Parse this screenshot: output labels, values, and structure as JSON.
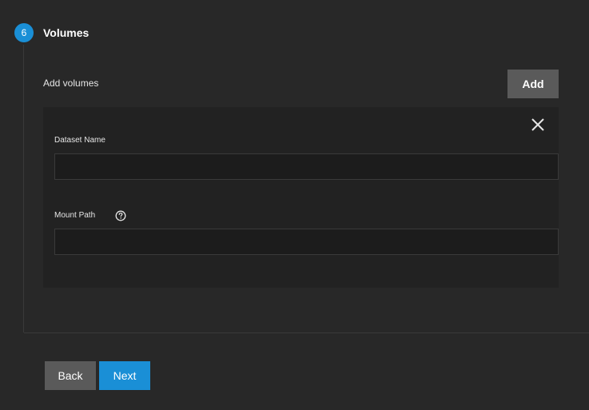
{
  "step": {
    "number": "6",
    "title": "Volumes"
  },
  "volumes": {
    "section_label": "Add volumes",
    "add_label": "Add",
    "dataset_name_label": "Dataset Name",
    "dataset_name_value": "",
    "mount_path_label": "Mount Path",
    "mount_path_value": ""
  },
  "icons": {
    "close": "close-icon",
    "help": "help-circle-icon"
  },
  "footer": {
    "back_label": "Back",
    "next_label": "Next"
  },
  "colors": {
    "accent": "#1a8fd6",
    "background": "#282828",
    "card": "#222222",
    "button_secondary": "#5a5a5a"
  }
}
